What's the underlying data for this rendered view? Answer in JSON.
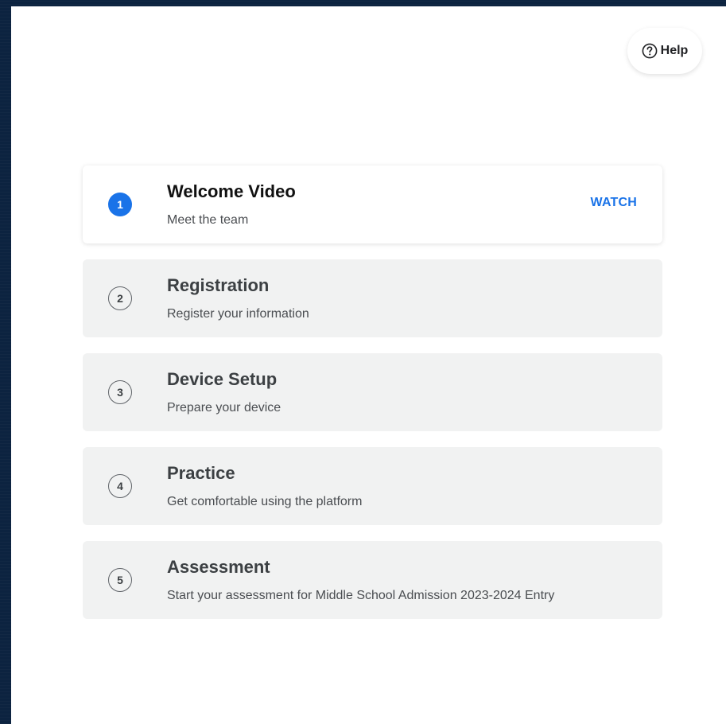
{
  "help": {
    "label": "Help",
    "icon": "question-circle-icon"
  },
  "steps": [
    {
      "number": "1",
      "title": "Welcome Video",
      "subtitle": "Meet the team",
      "action": "WATCH",
      "active": true
    },
    {
      "number": "2",
      "title": "Registration",
      "subtitle": "Register your information"
    },
    {
      "number": "3",
      "title": "Device Setup",
      "subtitle": "Prepare your device"
    },
    {
      "number": "4",
      "title": "Practice",
      "subtitle": "Get comfortable using the platform"
    },
    {
      "number": "5",
      "title": "Assessment",
      "subtitle": "Start your assessment for Middle School Admission 2023-2024 Entry"
    }
  ],
  "colors": {
    "accent": "#1a73e8",
    "background": "#0c2340",
    "card_inactive": "#f1f2f2",
    "card_active": "#ffffff"
  }
}
